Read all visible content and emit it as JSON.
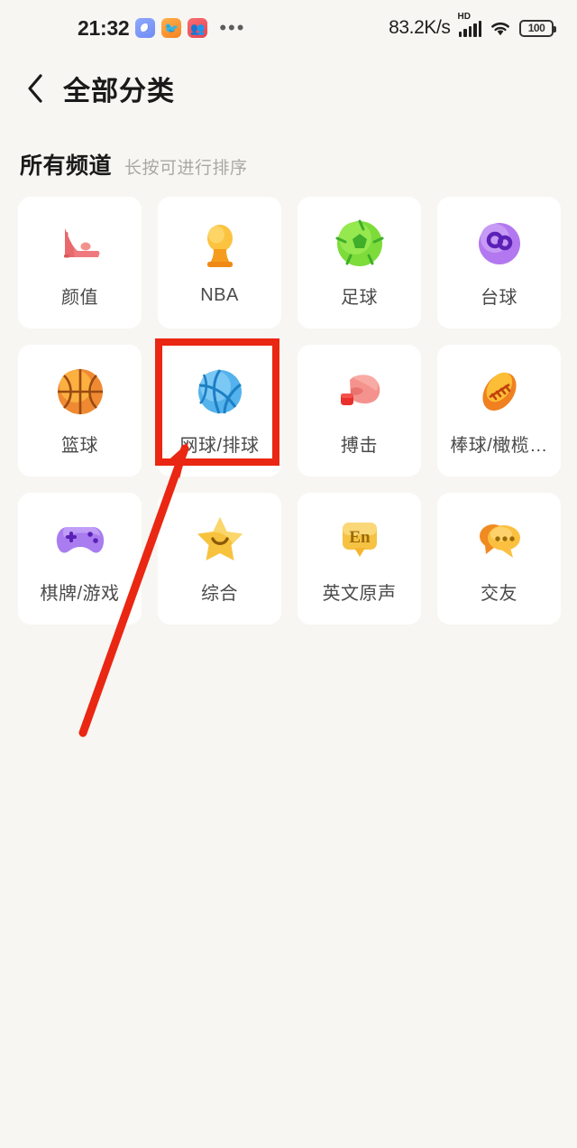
{
  "statusbar": {
    "clock": "21:32",
    "app_icons": [
      {
        "name": "camera-app-icon",
        "color": "#6f8bf5"
      },
      {
        "name": "bird-app-icon",
        "color": "#f58220"
      },
      {
        "name": "people-app-icon",
        "color": "#e8434f"
      }
    ],
    "overflow_dots": "•••",
    "network_speed": "83.2K/s",
    "hd_label": "HD",
    "signal_icon": "cellular-signal-icon",
    "wifi_icon": "wifi-icon",
    "battery_level": "100"
  },
  "navbar": {
    "back_icon": "back-chevron-icon",
    "title": "全部分类"
  },
  "section": {
    "title": "所有频道",
    "subtitle": "长按可进行排序"
  },
  "channels": [
    {
      "label": "颜值",
      "icon": "high-heel-icon",
      "color": "#ef6f73"
    },
    {
      "label": "NBA",
      "icon": "trophy-icon",
      "color": "#f7a938"
    },
    {
      "label": "足球",
      "icon": "soccer-ball-icon",
      "color": "#5ec832"
    },
    {
      "label": "台球",
      "icon": "billiards-icon",
      "color": "#b07dee"
    },
    {
      "label": "篮球",
      "icon": "basketball-icon",
      "color": "#f08a33"
    },
    {
      "label": "网球/排球",
      "icon": "volleyball-icon",
      "color": "#55b0e8"
    },
    {
      "label": "搏击",
      "icon": "boxing-glove-icon",
      "color": "#f4837f"
    },
    {
      "label": "棒球/橄榄…",
      "icon": "rugby-ball-icon",
      "color": "#f39224"
    },
    {
      "label": "棋牌/游戏",
      "icon": "gamepad-icon",
      "color": "#a874ee"
    },
    {
      "label": "综合",
      "icon": "star-smile-icon",
      "color": "#f6c445"
    },
    {
      "label": "英文原声",
      "icon": "en-badge-icon",
      "color": "#f4c044",
      "badge_text": "En"
    },
    {
      "label": "交友",
      "icon": "chat-bubbles-icon",
      "color": "#f7b733"
    }
  ],
  "annotation": {
    "highlight_box": "red-highlight-box",
    "arrow": "red-pointer-arrow",
    "color": "#ea2712",
    "target_label": "网球/排球"
  }
}
